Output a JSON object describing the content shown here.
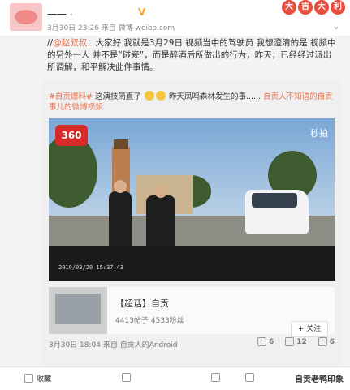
{
  "header": {
    "username": "一一 ·",
    "vbadge": "V",
    "meta": "3月30日 23:26 来自 微博 weibo.com",
    "logo": [
      "大",
      "吉",
      "大",
      "利"
    ],
    "more": "⌄"
  },
  "body": {
    "prefix": "//",
    "mention": "@赵叔叔",
    "text": "：大家好  我就是3月29日  视频当中的驾驶员  我想澄清的是  视频中的另外一人  并不是“碰瓷”，而是醉酒后所做出的行为，昨天，已经经过派出所调解，和平解决此件事情。"
  },
  "repost": {
    "tag": "#自贡爆料#",
    "line": " 这演技简直了 ",
    "line2": " 昨天凤鸣森林发生的事......",
    "link": " 自贡人不知道的自贡事儿的微博视频",
    "video": {
      "brand": "360",
      "overlay": "秒拍",
      "time": "2019/03/29  15:37:43"
    },
    "topic": {
      "title": "【超话】自贡",
      "stats": "4413帖子 4533粉丝",
      "follow": "+ 关注"
    },
    "meta": "3月30日 18:04 来自 自贡人的Android",
    "actions": [
      "6",
      "12",
      "6"
    ]
  },
  "bottom": {
    "collect": "收藏",
    "forward": "",
    "comment": "",
    "like": "",
    "watermark": "自贡老鸭印象"
  }
}
